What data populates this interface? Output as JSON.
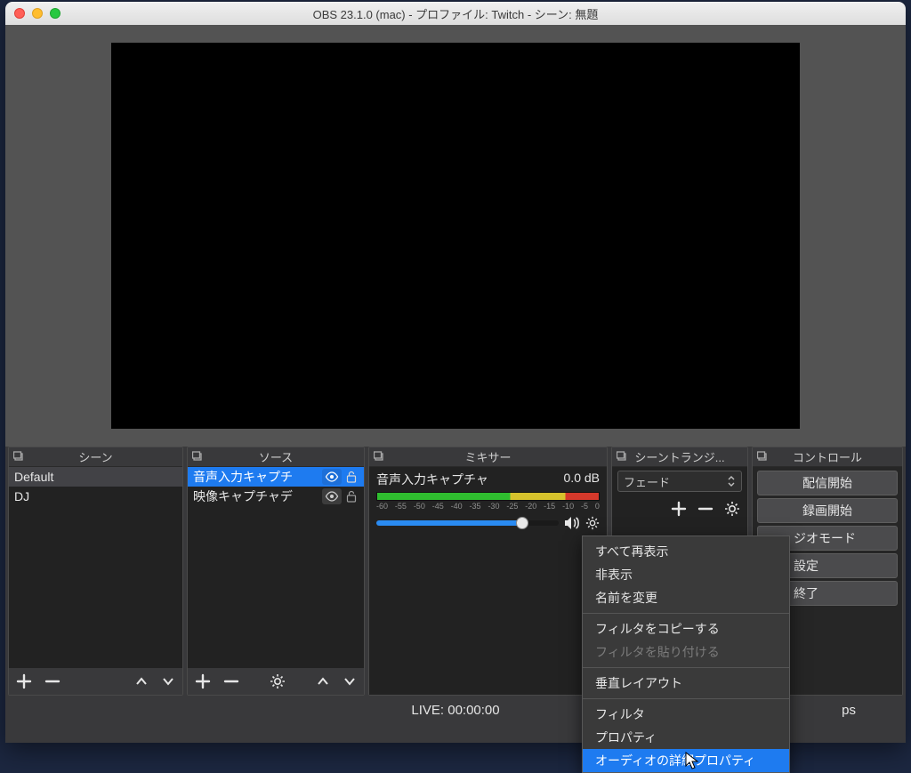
{
  "window": {
    "title": "OBS 23.1.0 (mac) - プロファイル: Twitch - シーン: 無題"
  },
  "panels": {
    "scenes": {
      "title": "シーン",
      "items": [
        "Default",
        "DJ"
      ]
    },
    "sources": {
      "title": "ソース",
      "items": [
        "音声入力キャプチ",
        "映像キャプチャデ"
      ]
    },
    "mixer": {
      "title": "ミキサー",
      "channel_name": "音声入力キャプチャ",
      "channel_level": "0.0 dB",
      "ticks": [
        "-60",
        "-55",
        "-50",
        "-45",
        "-40",
        "-35",
        "-30",
        "-25",
        "-20",
        "-15",
        "-10",
        "-5",
        "0"
      ]
    },
    "transitions": {
      "title": "シーントランジ...",
      "selected": "フェード"
    },
    "controls": {
      "title": "コントロール",
      "buttons": [
        "配信開始",
        "録画開始",
        "ジオモード",
        "設定",
        "終了"
      ]
    }
  },
  "status": {
    "live": "LIVE: 00:00:00",
    "fps_suffix": "ps"
  },
  "context_menu": {
    "items": [
      {
        "label": "すべて再表示",
        "type": "item"
      },
      {
        "label": "非表示",
        "type": "item"
      },
      {
        "label": "名前を変更",
        "type": "item"
      },
      {
        "type": "sep"
      },
      {
        "label": "フィルタをコピーする",
        "type": "item"
      },
      {
        "label": "フィルタを貼り付ける",
        "type": "item",
        "disabled": true
      },
      {
        "type": "sep"
      },
      {
        "label": "垂直レイアウト",
        "type": "item"
      },
      {
        "type": "sep"
      },
      {
        "label": "フィルタ",
        "type": "item"
      },
      {
        "label": "プロパティ",
        "type": "item"
      },
      {
        "label": "オーディオの詳細プロパティ",
        "type": "item",
        "highlight": true
      }
    ]
  }
}
